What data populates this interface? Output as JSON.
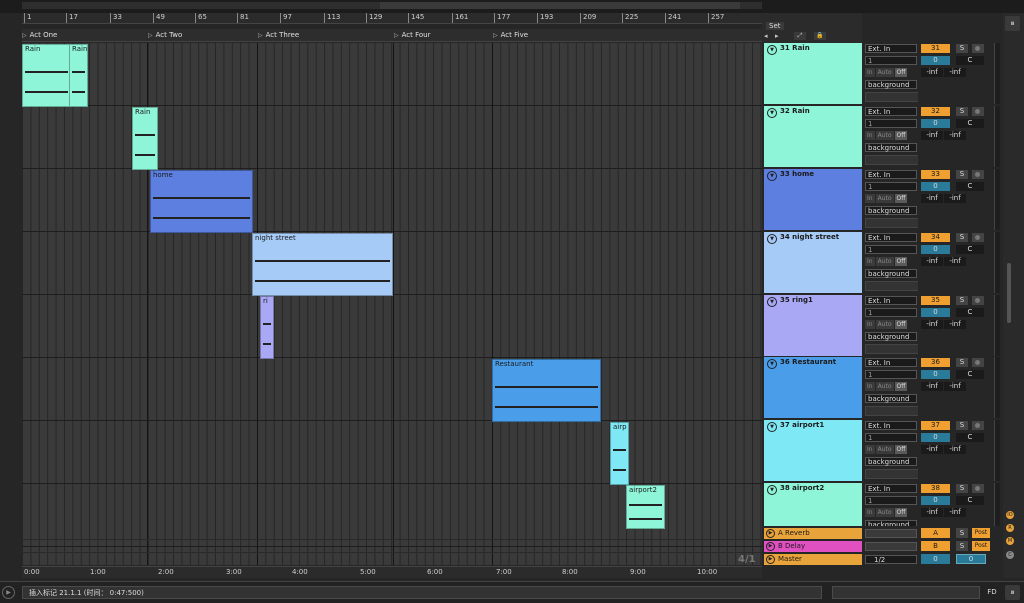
{
  "ruler_ticks": [
    "1",
    "17",
    "33",
    "49",
    "65",
    "81",
    "97",
    "113",
    "129",
    "145",
    "161",
    "177",
    "193",
    "209",
    "225",
    "241",
    "257"
  ],
  "locators": [
    "Act One",
    "Act Two",
    "Act Three",
    "Act Four",
    "Act Five"
  ],
  "time_ticks": [
    "0:00",
    "1:00",
    "2:00",
    "3:00",
    "4:00",
    "5:00",
    "6:00",
    "7:00",
    "8:00",
    "9:00",
    "10:00"
  ],
  "position_label": "4/1",
  "set_panel": {
    "label": "Set"
  },
  "clips": {
    "rain_a": "Rain",
    "rain_b": "Rain",
    "rain_c": "Rain",
    "home": "home",
    "night_street": "night street",
    "ring1": "ri",
    "restaurant": "Restaurant",
    "airport1": "airp",
    "airport2": "airport2"
  },
  "tracks": [
    {
      "name": "31 Rain",
      "num": "31",
      "color": "#8ef5d8"
    },
    {
      "name": "32 Rain",
      "num": "32",
      "color": "#8ef5d8"
    },
    {
      "name": "33 home",
      "num": "33",
      "color": "#5c7fe0"
    },
    {
      "name": "34 night street",
      "num": "34",
      "color": "#a7cbf7"
    },
    {
      "name": "35 ring1",
      "num": "35",
      "color": "#a8a8f5"
    },
    {
      "name": "36 Restaurant",
      "num": "36",
      "color": "#4a9de8"
    },
    {
      "name": "37 airport1",
      "num": "37",
      "color": "#7fe8f5"
    },
    {
      "name": "38 airport2",
      "num": "38",
      "color": "#8ef5d8"
    }
  ],
  "track_io": {
    "input_type": "Ext. In",
    "input_channel": "1",
    "monitor": [
      "In",
      "Auto",
      "Off"
    ],
    "output": "background",
    "volume": "0",
    "pan": "C",
    "peak_left": "-inf",
    "peak_right": "-inf",
    "solo": "S"
  },
  "returns": [
    {
      "name": "A Reverb",
      "letter": "A",
      "color": "#e8a33a"
    },
    {
      "name": "B Delay",
      "letter": "B",
      "color": "#e050c0"
    },
    {
      "name": "Master",
      "letter": "",
      "color": "#e8a33a"
    }
  ],
  "return_post": "Post",
  "master": {
    "output": "1/2",
    "vol_a": "0",
    "vol_b": "0"
  },
  "right_buttons": [
    "IO",
    "R",
    "M",
    "C"
  ],
  "status": {
    "message": "插入标记 21.1.1 (时间： 0:47:500)",
    "fd": "FD"
  }
}
